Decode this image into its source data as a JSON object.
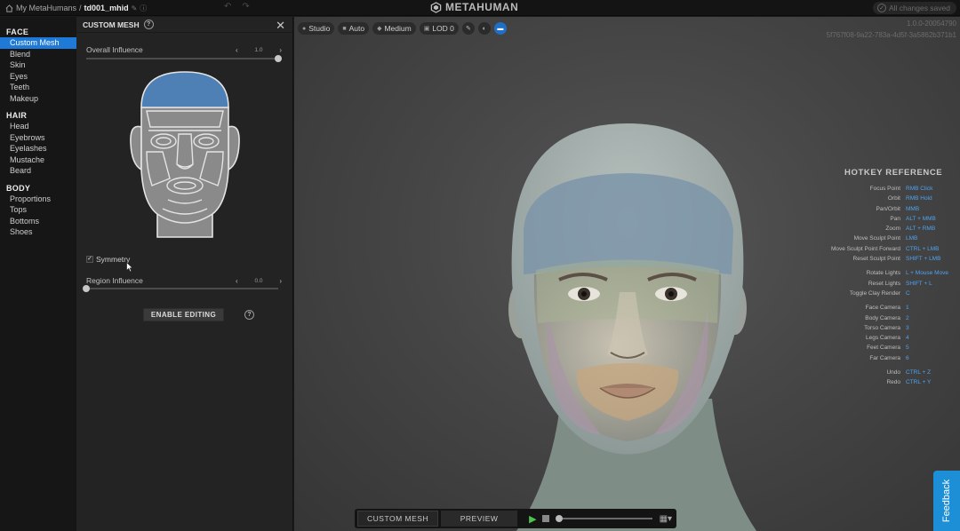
{
  "topbar": {
    "breadcrumb_root": "My MetaHumans",
    "separator": "/",
    "current_file": "td001_mhid",
    "app_title": "METAHUMAN",
    "save_status": "All changes saved"
  },
  "nav": {
    "sections": [
      {
        "title": "FACE",
        "items": [
          "Custom Mesh",
          "Blend",
          "Skin",
          "Eyes",
          "Teeth",
          "Makeup"
        ]
      },
      {
        "title": "HAIR",
        "items": [
          "Head",
          "Eyebrows",
          "Eyelashes",
          "Mustache",
          "Beard"
        ]
      },
      {
        "title": "BODY",
        "items": [
          "Proportions",
          "Tops",
          "Bottoms",
          "Shoes"
        ]
      }
    ],
    "active_item": "Custom Mesh",
    "active_color": "#1e7ad6"
  },
  "panel": {
    "title": "CUSTOM MESH",
    "overall_influence": {
      "label": "Overall Influence",
      "value": "1.0",
      "fraction": 1.0
    },
    "symmetry": {
      "label": "Symmetry",
      "checked": true
    },
    "region_influence": {
      "label": "Region Influence",
      "value": "0.0",
      "fraction": 0.0
    },
    "enable_button": "ENABLE EDITING",
    "selected_region_color": "#4e7fb5"
  },
  "viewport": {
    "toolbar": [
      {
        "icon": "light-bulb-icon",
        "label": "Studio"
      },
      {
        "icon": "camera-icon",
        "label": "Auto"
      },
      {
        "icon": "gem-icon",
        "label": "Medium"
      },
      {
        "icon": "layers-icon",
        "label": "LOD 0"
      }
    ],
    "round_buttons": [
      "wand-icon",
      "sphere-icon",
      "display-icon"
    ],
    "version": "1.0.0-20054790",
    "build_hash": "5f767f08-9a22-783a-4d5f-3a5862b371b1",
    "hotkey_title": "HOTKEY REFERENCE",
    "hotkey_color": "#4fa2ef",
    "hotkeys": [
      [
        {
          "name": "Focus Point",
          "key": "RMB Click"
        },
        {
          "name": "Orbit",
          "key": "RMB Hold"
        },
        {
          "name": "Pan/Orbit",
          "key": "MMB"
        },
        {
          "name": "Pan",
          "key": "ALT + MMB"
        },
        {
          "name": "Zoom",
          "key": "ALT + RMB"
        },
        {
          "name": "Move Sculpt Point",
          "key": "LMB"
        },
        {
          "name": "Move Sculpt Point Forward",
          "key": "CTRL + LMB"
        },
        {
          "name": "Reset Sculpt Point",
          "key": "SHIFT + LMB"
        }
      ],
      [
        {
          "name": "Rotate Lights",
          "key": "L + Mouse Move"
        },
        {
          "name": "Reset Lights",
          "key": "SHIFT + L"
        },
        {
          "name": "Toggle Clay Render",
          "key": "C"
        }
      ],
      [
        {
          "name": "Face Camera",
          "key": "1"
        },
        {
          "name": "Body Camera",
          "key": "2"
        },
        {
          "name": "Torso Camera",
          "key": "3"
        },
        {
          "name": "Legs Camera",
          "key": "4"
        },
        {
          "name": "Feet Camera",
          "key": "5"
        },
        {
          "name": "Far Camera",
          "key": "6"
        }
      ],
      [
        {
          "name": "Undo",
          "key": "CTRL + Z"
        },
        {
          "name": "Redo",
          "key": "CTRL + Y"
        }
      ]
    ]
  },
  "bottom": {
    "tab_custom_mesh": "CUSTOM MESH",
    "tab_preview": "PREVIEW",
    "timeline_progress": 0.0
  },
  "feedback_label": "Feedback"
}
